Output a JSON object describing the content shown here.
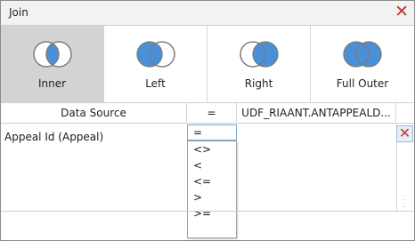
{
  "dialog": {
    "title": "Join",
    "close_symbol": "✕"
  },
  "join_types": [
    {
      "label": "Inner",
      "icon": "venn-inner-icon",
      "selected": true
    },
    {
      "label": "Left",
      "icon": "venn-left-icon",
      "selected": false
    },
    {
      "label": "Right",
      "icon": "venn-right-icon",
      "selected": false
    },
    {
      "label": "Full Outer",
      "icon": "venn-full-outer-icon",
      "selected": false
    }
  ],
  "colors": {
    "venn_fill": "#4a90d9",
    "venn_outline": "#7a7a7a",
    "selected_bg": "#d3d3d3",
    "close_red": "#c0392b"
  },
  "grid": {
    "headers": {
      "left": "Data Source",
      "operator": "=",
      "right": "UDF_RIAANT.ANTAPPEALD..."
    },
    "rows": [
      {
        "left_field": "Appeal Id (Appeal)",
        "operator": "="
      }
    ],
    "remove_symbol": "✕"
  },
  "operator_dropdown": {
    "options": [
      "<>",
      "<",
      "<=",
      ">",
      ">="
    ]
  }
}
